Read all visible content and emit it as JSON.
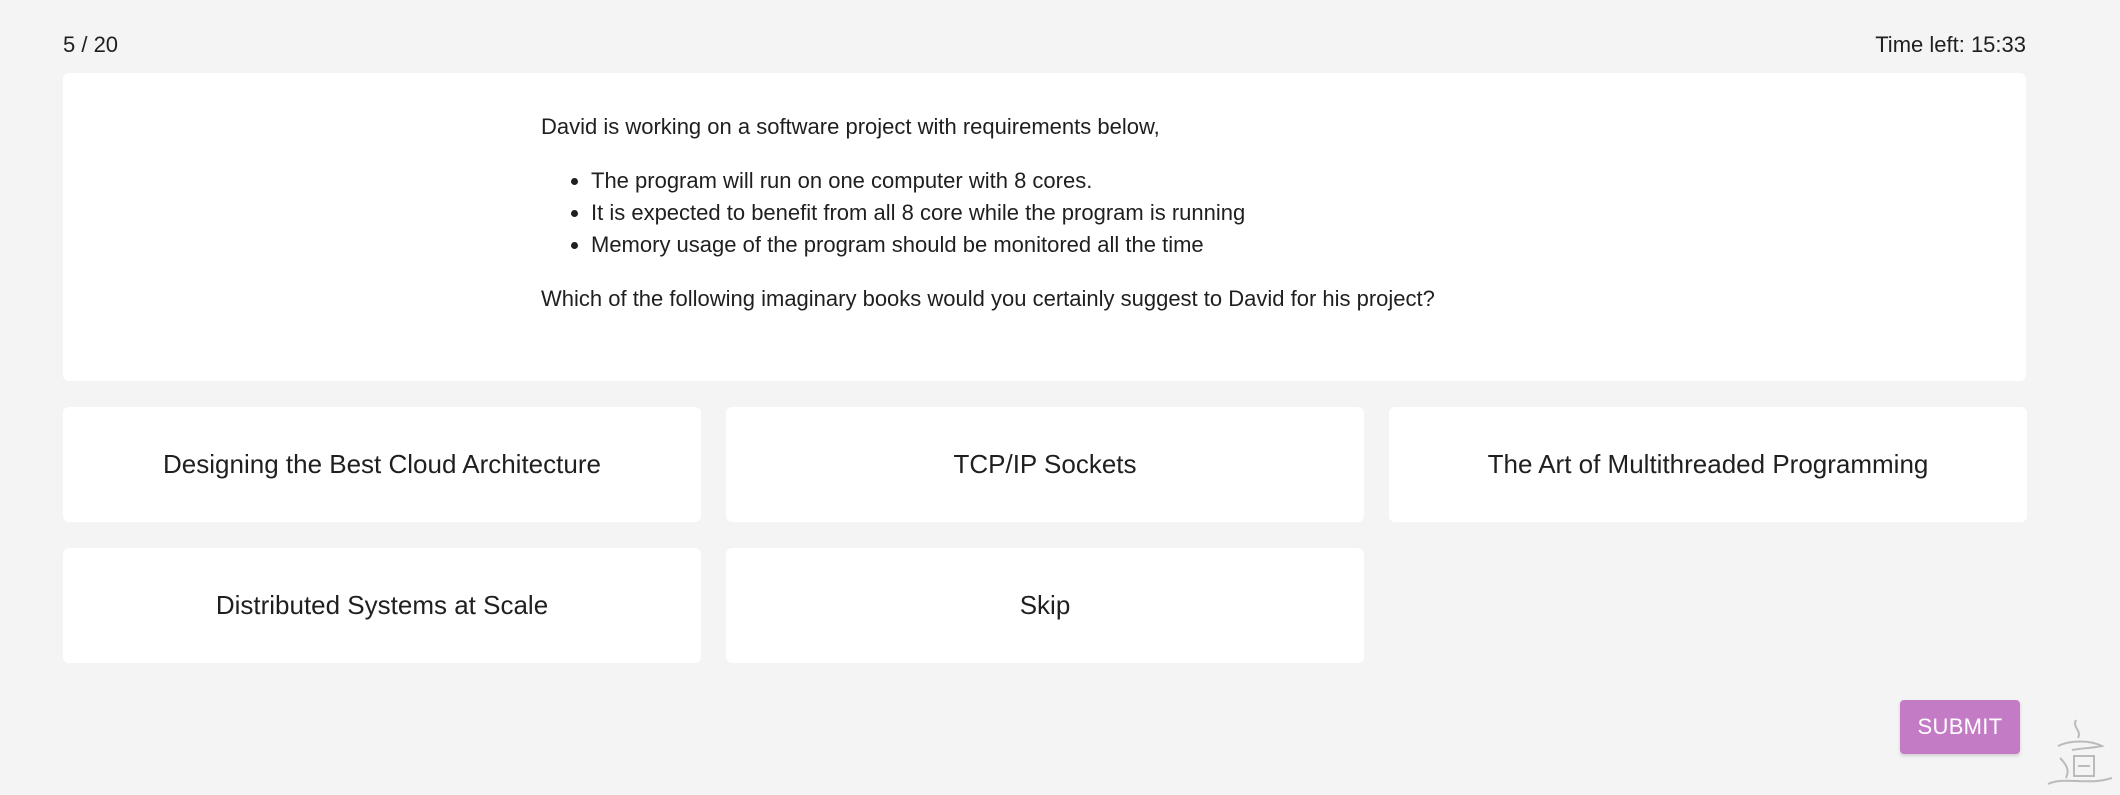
{
  "header": {
    "progress": "5 / 20",
    "timer": "Time left: 15:33"
  },
  "question": {
    "intro": "David is working on a software project with requirements below,",
    "requirements": [
      "The program will run on one computer with 8 cores.",
      "It is expected to benefit from all 8 core while the program is running",
      "Memory usage of the program should be monitored all the time"
    ],
    "prompt": "Which of the following imaginary books would you certainly suggest to David for his project?"
  },
  "answers": [
    "Designing the Best Cloud Architecture",
    "TCP/IP Sockets",
    "The Art of Multithreaded Programming",
    "Distributed Systems at Scale",
    "Skip"
  ],
  "actions": {
    "submit_label": "SUBMIT"
  },
  "colors": {
    "background": "#f4f4f4",
    "card": "#ffffff",
    "submit": "#c47bc6"
  },
  "icons": {
    "corner_mark": "watermark-seal-icon"
  }
}
